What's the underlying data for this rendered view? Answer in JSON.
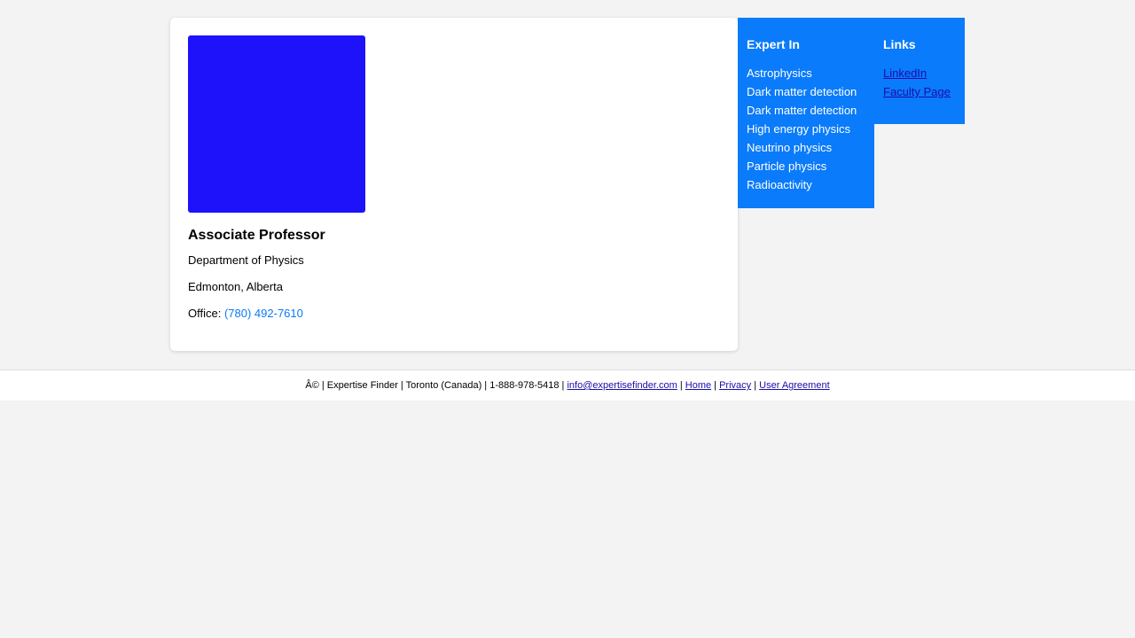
{
  "profile": {
    "title": "Associate Professor",
    "department": "Department of Physics",
    "location": "Edmonton, Alberta",
    "office_label": "Office:",
    "office_phone": "(780) 492-7610",
    "photo_color": "#1e12fb"
  },
  "expert_in": {
    "heading": "Expert In",
    "items": [
      "Astrophysics",
      "Dark matter detection",
      "Dark matter detection",
      "High energy physics",
      "Neutrino physics",
      "Particle physics",
      "Radioactivity"
    ]
  },
  "links": {
    "heading": "Links",
    "items": [
      "LinkedIn",
      "Faculty Page"
    ]
  },
  "footer": {
    "prefix": "Â© | Expertise Finder | Toronto (Canada) | 1-888-978-5418 |",
    "email": "info@expertisefinder.com",
    "home": "Home",
    "privacy": "Privacy",
    "user_agreement": "User Agreement",
    "separator": "|"
  },
  "colors": {
    "panel_bg": "#0a7bfa",
    "link": "#1a0dab",
    "phone": "#0a7af6",
    "page_bg": "#f3f3f3"
  }
}
